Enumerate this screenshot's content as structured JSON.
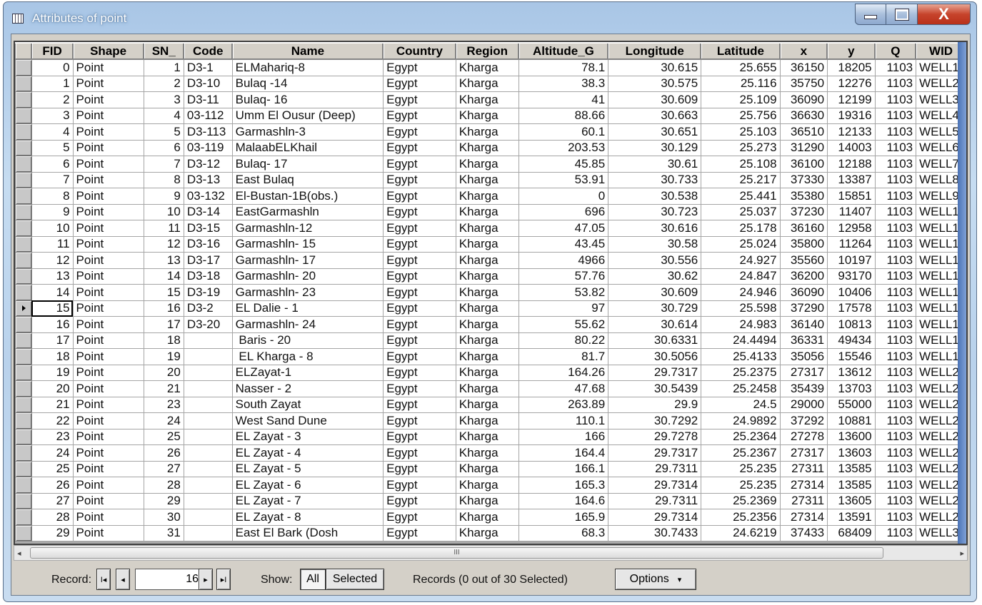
{
  "window": {
    "title": "Attributes of point",
    "close_glyph": "X"
  },
  "table": {
    "columns": [
      "FID",
      "Shape",
      "SN_",
      "Code",
      "Name",
      "Country",
      "Region",
      "Altitude_G",
      "Longitude",
      "Latitude",
      "x",
      "y",
      "Q",
      "WID"
    ],
    "current_row_index": 15,
    "rows": [
      [
        "0",
        "Point",
        "1",
        "D3-1",
        "ELMahariq-8",
        "Egypt",
        "Kharga",
        "78.1",
        "30.615",
        "25.655",
        "36150",
        "18205",
        "1103",
        "WELL1"
      ],
      [
        "1",
        "Point",
        "2",
        "D3-10",
        "Bulaq -14",
        "Egypt",
        "Kharga",
        "38.3",
        "30.575",
        "25.116",
        "35750",
        "12276",
        "1103",
        "WELL2"
      ],
      [
        "2",
        "Point",
        "3",
        "D3-11",
        "Bulaq- 16",
        "Egypt",
        "Kharga",
        "41",
        "30.609",
        "25.109",
        "36090",
        "12199",
        "1103",
        "WELL3"
      ],
      [
        "3",
        "Point",
        "4",
        "03-112",
        "Umm El Ousur (Deep)",
        "Egypt",
        "Kharga",
        "88.66",
        "30.663",
        "25.756",
        "36630",
        "19316",
        "1103",
        "WELL4"
      ],
      [
        "4",
        "Point",
        "5",
        "D3-113",
        "Garmashln-3",
        "Egypt",
        "Kharga",
        "60.1",
        "30.651",
        "25.103",
        "36510",
        "12133",
        "1103",
        "WELL5"
      ],
      [
        "5",
        "Point",
        "6",
        "03-119",
        "MalaabELKhail",
        "Egypt",
        "Kharga",
        "203.53",
        "30.129",
        "25.273",
        "31290",
        "14003",
        "1103",
        "WELL6"
      ],
      [
        "6",
        "Point",
        "7",
        "D3-12",
        "Bulaq- 17",
        "Egypt",
        "Kharga",
        "45.85",
        "30.61",
        "25.108",
        "36100",
        "12188",
        "1103",
        "WELL7"
      ],
      [
        "7",
        "Point",
        "8",
        "D3-13",
        "East Bulaq",
        "Egypt",
        "Kharga",
        "53.91",
        "30.733",
        "25.217",
        "37330",
        "13387",
        "1103",
        "WELL8"
      ],
      [
        "8",
        "Point",
        "9",
        "03-132",
        "El-Bustan-1B(obs.)",
        "Egypt",
        "Kharga",
        "0",
        "30.538",
        "25.441",
        "35380",
        "15851",
        "1103",
        "WELL9"
      ],
      [
        "9",
        "Point",
        "10",
        "D3-14",
        "EastGarmashln",
        "Egypt",
        "Kharga",
        "696",
        "30.723",
        "25.037",
        "37230",
        "11407",
        "1103",
        "WELL1"
      ],
      [
        "10",
        "Point",
        "11",
        "D3-15",
        "Garmashln-12",
        "Egypt",
        "Kharga",
        "47.05",
        "30.616",
        "25.178",
        "36160",
        "12958",
        "1103",
        "WELL1"
      ],
      [
        "11",
        "Point",
        "12",
        "D3-16",
        "Garmashln- 15",
        "Egypt",
        "Kharga",
        "43.45",
        "30.58",
        "25.024",
        "35800",
        "11264",
        "1103",
        "WELL1"
      ],
      [
        "12",
        "Point",
        "13",
        "D3-17",
        "Garmashln- 17",
        "Egypt",
        "Kharga",
        "4966",
        "30.556",
        "24.927",
        "35560",
        "10197",
        "1103",
        "WELL1"
      ],
      [
        "13",
        "Point",
        "14",
        "D3-18",
        "Garmashln- 20",
        "Egypt",
        "Kharga",
        "57.76",
        "30.62",
        "24.847",
        "36200",
        "93170",
        "1103",
        "WELL1"
      ],
      [
        "14",
        "Point",
        "15",
        "D3-19",
        "Garmashln- 23",
        "Egypt",
        "Kharga",
        "53.82",
        "30.609",
        "24.946",
        "36090",
        "10406",
        "1103",
        "WELL1"
      ],
      [
        "15",
        "Point",
        "16",
        "D3-2",
        "EL Dalie - 1",
        "Egypt",
        "Kharga",
        "97",
        "30.729",
        "25.598",
        "37290",
        "17578",
        "1103",
        "WELL1"
      ],
      [
        "16",
        "Point",
        "17",
        "D3-20",
        "Garmashln- 24",
        "Egypt",
        "Kharga",
        "55.62",
        "30.614",
        "24.983",
        "36140",
        "10813",
        "1103",
        "WELL1"
      ],
      [
        "17",
        "Point",
        "18",
        "",
        " Baris - 20",
        "Egypt",
        "Kharga",
        "80.22",
        "30.6331",
        "24.4494",
        "36331",
        "49434",
        "1103",
        "WELL1"
      ],
      [
        "18",
        "Point",
        "19",
        "",
        " EL Kharga - 8",
        "Egypt",
        "Kharga",
        "81.7",
        "30.5056",
        "25.4133",
        "35056",
        "15546",
        "1103",
        "WELL1"
      ],
      [
        "19",
        "Point",
        "20",
        "",
        "ELZayat-1",
        "Egypt",
        "Kharga",
        "164.26",
        "29.7317",
        "25.2375",
        "27317",
        "13612",
        "1103",
        "WELL2"
      ],
      [
        "20",
        "Point",
        "21",
        "",
        "Nasser - 2",
        "Egypt",
        "Kharga",
        "47.68",
        "30.5439",
        "25.2458",
        "35439",
        "13703",
        "1103",
        "WELL2"
      ],
      [
        "21",
        "Point",
        "23",
        "",
        "South Zayat",
        "Egypt",
        "Kharga",
        "263.89",
        "29.9",
        "24.5",
        "29000",
        "55000",
        "1103",
        "WELL2"
      ],
      [
        "22",
        "Point",
        "24",
        "",
        "West Sand Dune",
        "Egypt",
        "Kharga",
        "110.1",
        "30.7292",
        "24.9892",
        "37292",
        "10881",
        "1103",
        "WELL2"
      ],
      [
        "23",
        "Point",
        "25",
        "",
        "EL Zayat - 3",
        "Egypt",
        "Kharga",
        "166",
        "29.7278",
        "25.2364",
        "27278",
        "13600",
        "1103",
        "WELL2"
      ],
      [
        "24",
        "Point",
        "26",
        "",
        "EL Zayat - 4",
        "Egypt",
        "Kharga",
        "164.4",
        "29.7317",
        "25.2367",
        "27317",
        "13603",
        "1103",
        "WELL2"
      ],
      [
        "25",
        "Point",
        "27",
        "",
        "EL Zayat - 5",
        "Egypt",
        "Kharga",
        "166.1",
        "29.7311",
        "25.235",
        "27311",
        "13585",
        "1103",
        "WELL2"
      ],
      [
        "26",
        "Point",
        "28",
        "",
        "EL Zayat - 6",
        "Egypt",
        "Kharga",
        "165.3",
        "29.7314",
        "25.235",
        "27314",
        "13585",
        "1103",
        "WELL2"
      ],
      [
        "27",
        "Point",
        "29",
        "",
        "EL Zayat - 7",
        "Egypt",
        "Kharga",
        "164.6",
        "29.7311",
        "25.2369",
        "27311",
        "13605",
        "1103",
        "WELL2"
      ],
      [
        "28",
        "Point",
        "30",
        "",
        "EL Zayat - 8",
        "Egypt",
        "Kharga",
        "165.9",
        "29.7314",
        "25.2356",
        "27314",
        "13591",
        "1103",
        "WELL2"
      ],
      [
        "29",
        "Point",
        "31",
        "",
        "East El Bark (Dosh",
        "Egypt",
        "Kharga",
        "68.3",
        "30.7433",
        "24.6219",
        "37433",
        "68409",
        "1103",
        "WELL3"
      ]
    ]
  },
  "footer": {
    "record_label": "Record:",
    "record_value": "16",
    "show_label": "Show:",
    "show_all": "All",
    "show_selected": "Selected",
    "show_active": "All",
    "records_status": "Records (0 out of 30 Selected)",
    "options_label": "Options",
    "options_arrow": "▾",
    "first_glyph": "I◂",
    "prev_glyph": "◂",
    "next_glyph": "▸",
    "last_glyph": "▸I"
  },
  "scrollbar": {
    "grip": "III",
    "left_arrow": "◂",
    "right_arrow": "▸"
  }
}
